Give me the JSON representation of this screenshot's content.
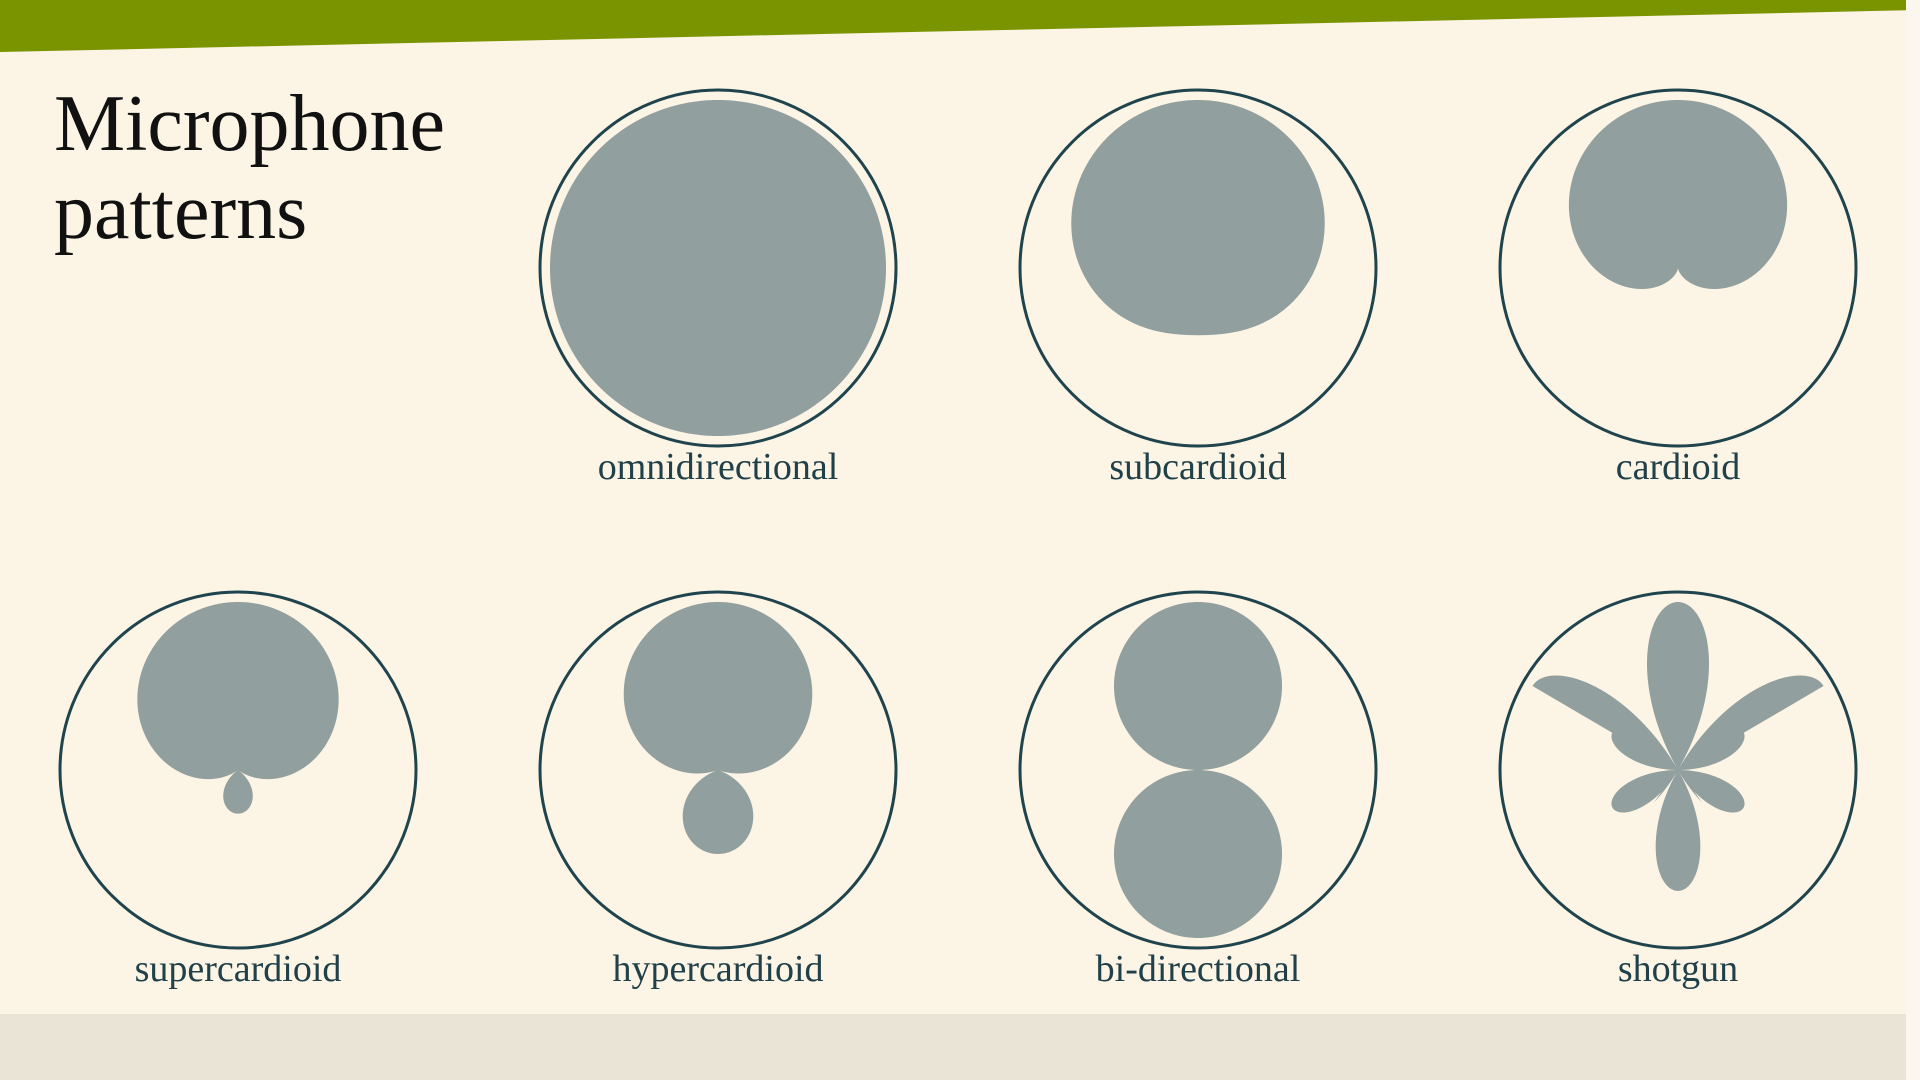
{
  "title": "Microphone\npatterns",
  "colors": {
    "accent_band": "#7a9400",
    "background": "#fcf4e4",
    "pattern_fill": "#929f9f",
    "outline": "#1f444d",
    "label": "#20404a",
    "footer": "#eae4d6"
  },
  "patterns": [
    {
      "id": "omnidirectional",
      "label": "omnidirectional",
      "a": 1.0,
      "k": 1
    },
    {
      "id": "subcardioid",
      "label": "subcardioid",
      "a": 0.7,
      "k": 1
    },
    {
      "id": "cardioid",
      "label": "cardioid",
      "a": 0.5,
      "k": 1
    },
    {
      "id": "supercardioid",
      "label": "supercardioid",
      "a": 0.37,
      "k": 1
    },
    {
      "id": "hypercardioid",
      "label": "hypercardioid",
      "a": 0.25,
      "k": 1
    },
    {
      "id": "bi-directional",
      "label": "bi-directional",
      "a": 0.0,
      "k": 1
    },
    {
      "id": "shotgun",
      "label": "shotgun",
      "a": 0.0,
      "k": 3
    }
  ]
}
